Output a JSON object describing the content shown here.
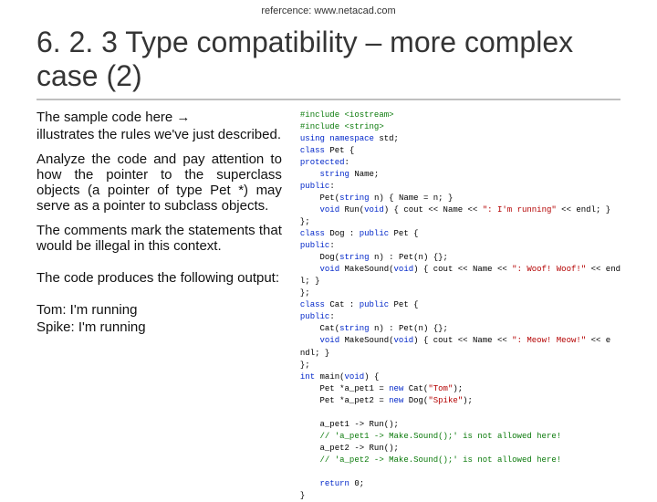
{
  "ref": "refercence: www.netacad.com",
  "title": "6. 2. 3 Type compatibility – more complex case (2)",
  "left": {
    "p1": "The sample code here →",
    "p2": "illustrates the rules we've just described.",
    "p3": "Analyze the code and pay attention to how the pointer to the superclass objects (a pointer of type Pet *) may serve as a pointer to subclass objects.",
    "p4": "The comments mark the statements that would be illegal in this context.",
    "p5": "The code produces the following output:",
    "o1": "Tom: I'm running",
    "o2": "Spike: I'm running"
  },
  "code": {
    "l1a": "#include ",
    "l1b": "<iostream>",
    "l2a": "#include ",
    "l2b": "<string>",
    "l3a": "using namespace ",
    "l3b": "std;",
    "l4a": "class ",
    "l4b": "Pet {",
    "l5a": "protected",
    "l5b": ":",
    "l6a": "    string ",
    "l6b": "Name;",
    "l7a": "public",
    "l7b": ":",
    "l8a": "    Pet(",
    "l8b": "string ",
    "l8c": "n) { Name = n; }",
    "l9a": "    void ",
    "l9b": "Run(",
    "l9c": "void",
    "l9d": ") { cout << Name << ",
    "l9e": "\": I'm running\"",
    "l9f": " << endl; }",
    "l10": "};",
    "l11a": "class ",
    "l11b": "Dog : ",
    "l11c": "public ",
    "l11d": "Pet {",
    "l12a": "public",
    "l12b": ":",
    "l13a": "    Dog(",
    "l13b": "string ",
    "l13c": "n) : Pet(n) {};",
    "l14a": "    void ",
    "l14b": "MakeSound(",
    "l14c": "void",
    "l14d": ") { cout << Name << ",
    "l14e": "\": Woof! Woof!\"",
    "l14f": " << end",
    "l15": "l; }",
    "l16": "};",
    "l17a": "class ",
    "l17b": "Cat : ",
    "l17c": "public ",
    "l17d": "Pet {",
    "l18a": "public",
    "l18b": ":",
    "l19a": "    Cat(",
    "l19b": "string ",
    "l19c": "n) : Pet(n) {};",
    "l20a": "    void ",
    "l20b": "MakeSound(",
    "l20c": "void",
    "l20d": ") { cout << Name << ",
    "l20e": "\": Meow! Meow!\"",
    "l20f": " << e",
    "l21": "ndl; }",
    "l22": "};",
    "l23a": "int ",
    "l23b": "main(",
    "l23c": "void",
    "l23d": ") {",
    "l24a": "    Pet *a_pet1 = ",
    "l24b": "new ",
    "l24c": "Cat(",
    "l24d": "\"Tom\"",
    "l24e": ");",
    "l25a": "    Pet *a_pet2 = ",
    "l25b": "new ",
    "l25c": "Dog(",
    "l25d": "\"Spike\"",
    "l25e": ");",
    "blank1": " ",
    "l26": "    a_pet1 -> Run();",
    "l27": "    // 'a_pet1 -> Make.Sound();' is not allowed here!",
    "l28": "    a_pet2 -> Run();",
    "l29": "    // 'a_pet2 -> Make.Sound();' is not allowed here!",
    "blank2": " ",
    "l30a": "    return ",
    "l30b": "0;",
    "l31": "}"
  }
}
